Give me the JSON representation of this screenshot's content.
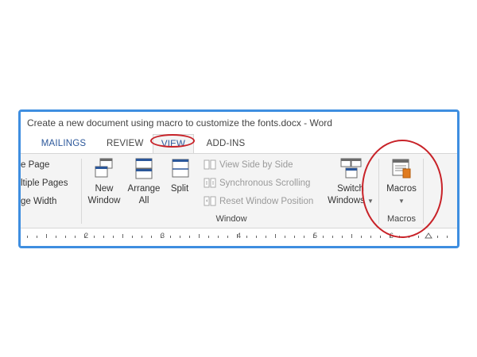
{
  "window": {
    "title": "Create a new document using macro to customize the fonts.docx - Word"
  },
  "tabs": [
    {
      "label": "MAILINGS"
    },
    {
      "label": "REVIEW"
    },
    {
      "label": "VIEW",
      "active": true
    },
    {
      "label": "ADD-INS"
    }
  ],
  "zoom_group": {
    "items": [
      "e Page",
      "ltiple Pages",
      "ge Width"
    ]
  },
  "window_group": {
    "label": "Window",
    "new_window": [
      "New",
      "Window"
    ],
    "arrange_all": [
      "Arrange",
      "All"
    ],
    "split": "Split",
    "view_side_by_side": "View Side by Side",
    "synchronous_scrolling": "Synchronous Scrolling",
    "reset_window_position": "Reset Window Position",
    "switch_windows": [
      "Switch",
      "Windows"
    ]
  },
  "macros_group": {
    "label": "Macros",
    "button": "Macros"
  },
  "ruler": {
    "numbers": [
      "2",
      "3",
      "4",
      "5",
      "6"
    ]
  },
  "colors": {
    "accent": "#2b579a",
    "highlight": "#c82228",
    "frame": "#3e8ee0"
  }
}
